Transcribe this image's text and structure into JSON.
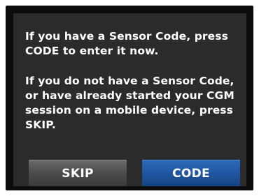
{
  "dialog": {
    "paragraph_1": "If you have a Sensor Code, press CODE to enter it now.",
    "paragraph_2": "If you do not have a Sensor Code, or have already started your CGM session on a mobile device, press SKIP."
  },
  "buttons": {
    "skip_label": "SKIP",
    "code_label": "CODE"
  },
  "colors": {
    "screen_background": "#2b2b2b",
    "frame": "#0c0c0c",
    "skip_button": "#4e4e4e",
    "code_button": "#1f56a1",
    "text": "#ffffff"
  }
}
